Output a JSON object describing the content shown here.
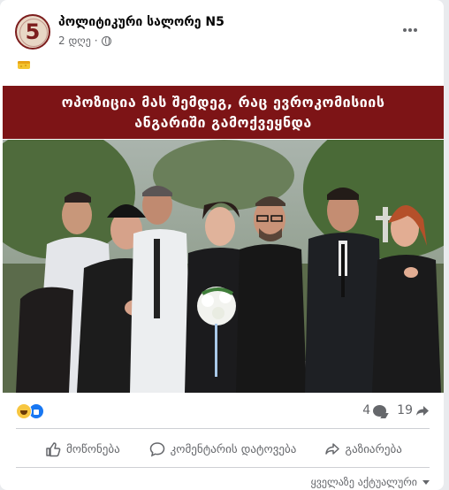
{
  "post": {
    "page_name": "პოლიტიკური სალორე N5",
    "avatar_text": "5",
    "time": "2 დღე",
    "separator": "·",
    "text_emoji": "🧽"
  },
  "banner": {
    "line1": "ოპოზიცია მას შემდეგ, რაც ევროკომისიის",
    "line2": "ანგარიში გამოქვეყნდა"
  },
  "stats": {
    "comments": "4",
    "shares": "19"
  },
  "actions": {
    "like": "მოწონება",
    "comment": "კომენტარის დატოვება",
    "share": "გაზიარება"
  },
  "sort": {
    "label": "ყველაზე აქტუალური"
  },
  "icons": {
    "more": "more-horizontal-icon",
    "globe": "globe-icon",
    "like": "thumbs-up-icon",
    "comment": "comment-bubble-icon",
    "share": "share-arrow-icon",
    "reaction_haha": "haha-reaction-icon",
    "reaction_like": "like-reaction-icon"
  },
  "colors": {
    "banner": "#7d1416",
    "text_secondary": "#65676b",
    "reaction_like": "#1877f2",
    "reaction_haha": "#f7c640"
  }
}
